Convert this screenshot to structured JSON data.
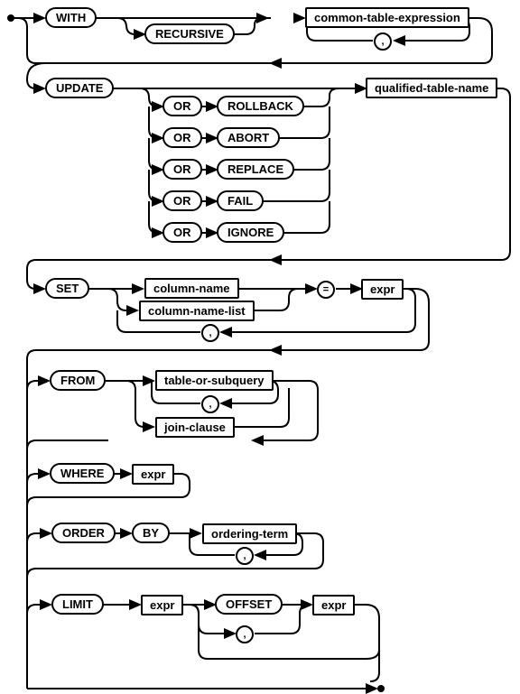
{
  "keywords": {
    "with": "WITH",
    "recursive": "RECURSIVE",
    "update": "UPDATE",
    "or1": "OR",
    "or2": "OR",
    "or3": "OR",
    "or4": "OR",
    "or5": "OR",
    "rollback": "ROLLBACK",
    "abort": "ABORT",
    "replace": "REPLACE",
    "fail": "FAIL",
    "ignore": "IGNORE",
    "set": "SET",
    "eq": "=",
    "from": "FROM",
    "where": "WHERE",
    "order": "ORDER",
    "by": "BY",
    "limit": "LIMIT",
    "offset": "OFFSET"
  },
  "nonterminals": {
    "cte": "common-table-expression",
    "qtn": "qualified-table-name",
    "colname": "column-name",
    "colnamelist": "column-name-list",
    "expr1": "expr",
    "tos": "table-or-subquery",
    "jc": "join-clause",
    "expr2": "expr",
    "ot": "ordering-term",
    "expr3": "expr",
    "expr4": "expr"
  },
  "symbols": {
    "comma": ","
  }
}
